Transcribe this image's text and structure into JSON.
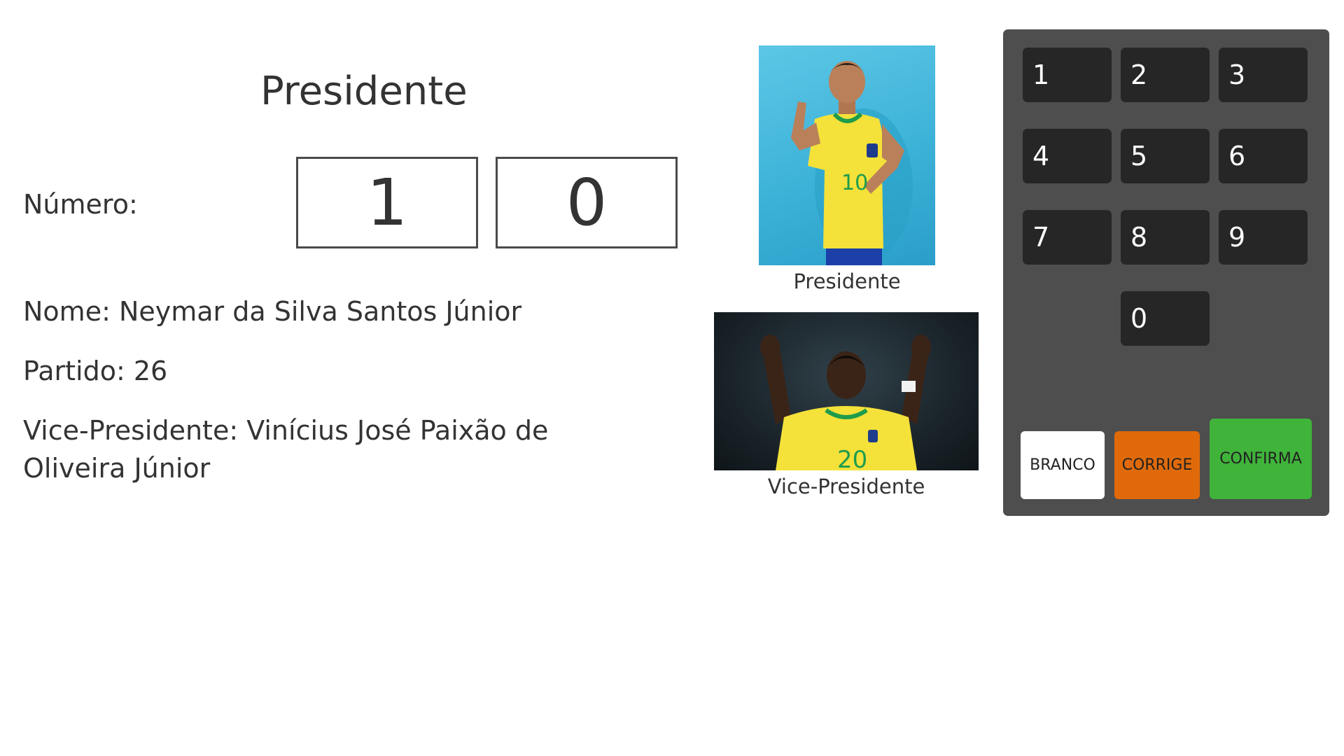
{
  "ballot": {
    "role_title": "Presidente",
    "numero_label": "Número:",
    "digits": [
      "1",
      "0"
    ],
    "nome_line": "Nome: Neymar da Silva Santos Júnior",
    "partido_line": "Partido: 26",
    "vice_line": "Vice-Presidente: Vinícius José Paixão de Oliveira Júnior"
  },
  "photos": {
    "president_caption": "Presidente",
    "vice_caption": "Vice-Presidente"
  },
  "keypad": {
    "keys": [
      "1",
      "2",
      "3",
      "4",
      "5",
      "6",
      "7",
      "8",
      "9",
      "0"
    ],
    "branco_label": "BRANCO",
    "corrige_label": "CORRIGE",
    "confirma_label": "CONFIRMA"
  },
  "colors": {
    "keypad_bg": "#4e4e4e",
    "key_bg": "#262626",
    "branco": "#ffffff",
    "corrige": "#e06a0a",
    "confirma": "#3fb33a",
    "jersey_yellow": "#f4e13a",
    "jersey_green": "#1e9c4c"
  }
}
